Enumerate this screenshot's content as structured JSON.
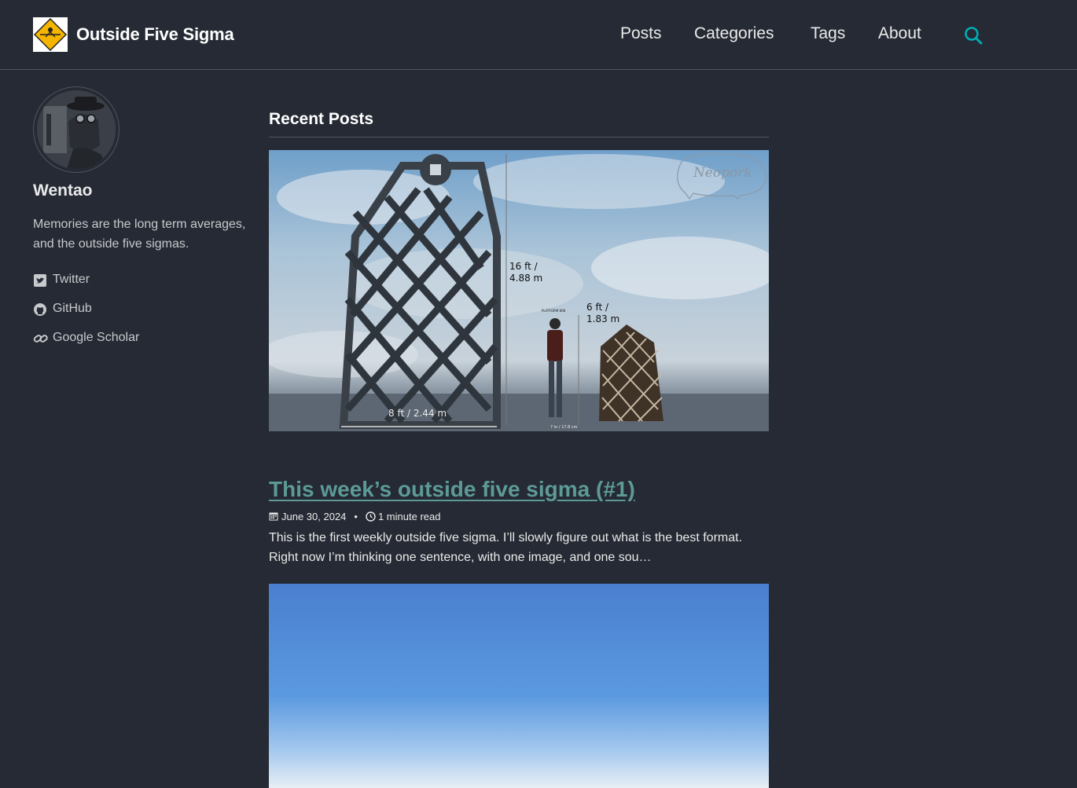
{
  "header": {
    "site_title": "Outside Five Sigma",
    "nav": [
      {
        "label": "Posts"
      },
      {
        "label": "Categories"
      },
      {
        "label": "Tags"
      },
      {
        "label": "About"
      }
    ],
    "search_icon": "search-icon",
    "accent_color": "#00adb5"
  },
  "sidebar": {
    "author_name": "Wentao",
    "bio": "Memories are the long term averages, and the outside five sigmas.",
    "links": [
      {
        "label": "Twitter",
        "icon": "twitter-square-icon"
      },
      {
        "label": "GitHub",
        "icon": "github-icon"
      },
      {
        "label": "Google Scholar",
        "icon": "link-icon"
      }
    ]
  },
  "main": {
    "section_title": "Recent Posts",
    "teaser_image": {
      "watermark": "Neopork",
      "label_height_tall": "16 ft /",
      "label_height_tall_m": "4.88 m",
      "label_height_short": "6 ft /",
      "label_height_short_m": "1.83 m",
      "label_width": "8 ft / 2.44 m",
      "label_platform": "PLATFORM 808",
      "label_small": "7 in / 17.8 cm"
    },
    "posts": [
      {
        "title": "This week’s outside five sigma (#1)",
        "date": "June 30, 2024",
        "read_time": "1 minute read",
        "excerpt": "This is the first weekly outside five sigma. I’ll slowly figure out what is the best format. Right now I’m thinking one sentence, with one image, and one sou…"
      }
    ]
  }
}
